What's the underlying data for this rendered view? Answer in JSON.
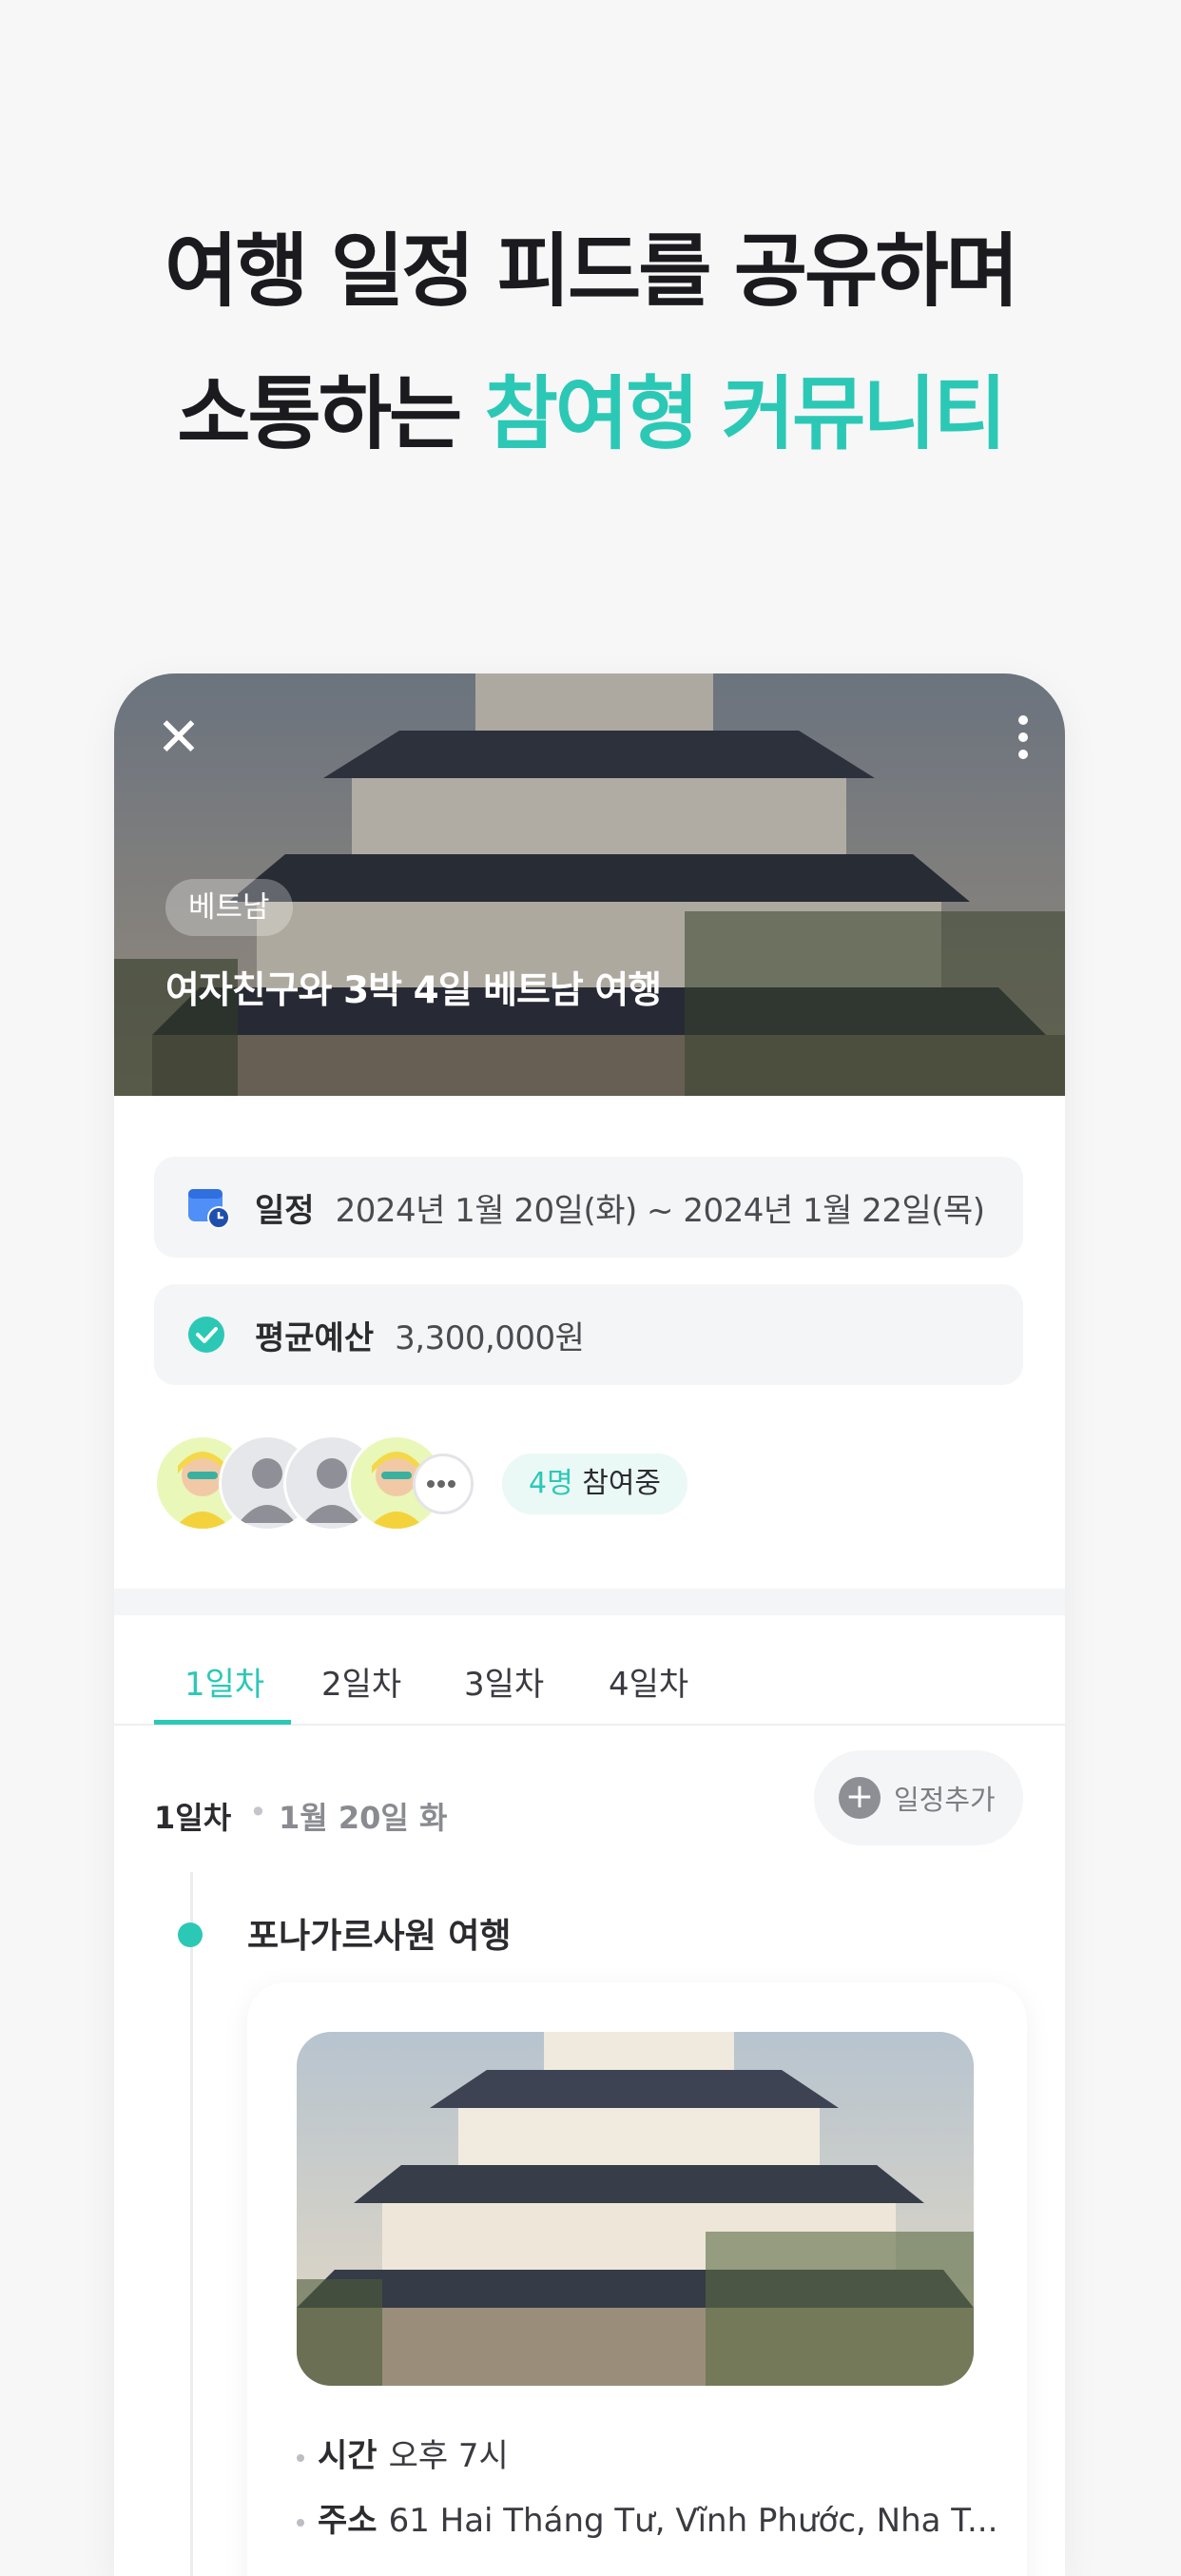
{
  "headline": {
    "line1": "여행 일정 피드를 공유하며",
    "line2_plain": "소통하는 ",
    "line2_accent": "참여형 커뮤니티"
  },
  "hero": {
    "close_icon": "close-icon",
    "more_icon": "more-vertical-icon",
    "country": "베트남",
    "title": "여자친구와 3박 4일 베트남 여행"
  },
  "schedule": {
    "icon": "calendar-clock-icon",
    "label": "일정",
    "value": "2024년 1월 20일(화) ~ 2024년 1월 22일(목)"
  },
  "budget": {
    "icon": "check-circle-icon",
    "label": "평균예산",
    "value": "3,300,000원"
  },
  "participants": {
    "count": "4명",
    "suffix": " 참여중"
  },
  "tabs": [
    "1일차",
    "2일차",
    "3일차",
    "4일차"
  ],
  "day": {
    "label": "1일차",
    "separator": "•",
    "date": "1월 20일 화",
    "add_label": "일정추가"
  },
  "place": {
    "name": "포나가르사원 여행",
    "time_label": "시간",
    "time_value": "오후 7시",
    "address_label": "주소",
    "address_value": "61 Hai Tháng Tư, Vĩnh Phước, Nha T..."
  },
  "colors": {
    "accent": "#2cc8b6",
    "background": "#f7f7f8",
    "card": "#ffffff"
  }
}
